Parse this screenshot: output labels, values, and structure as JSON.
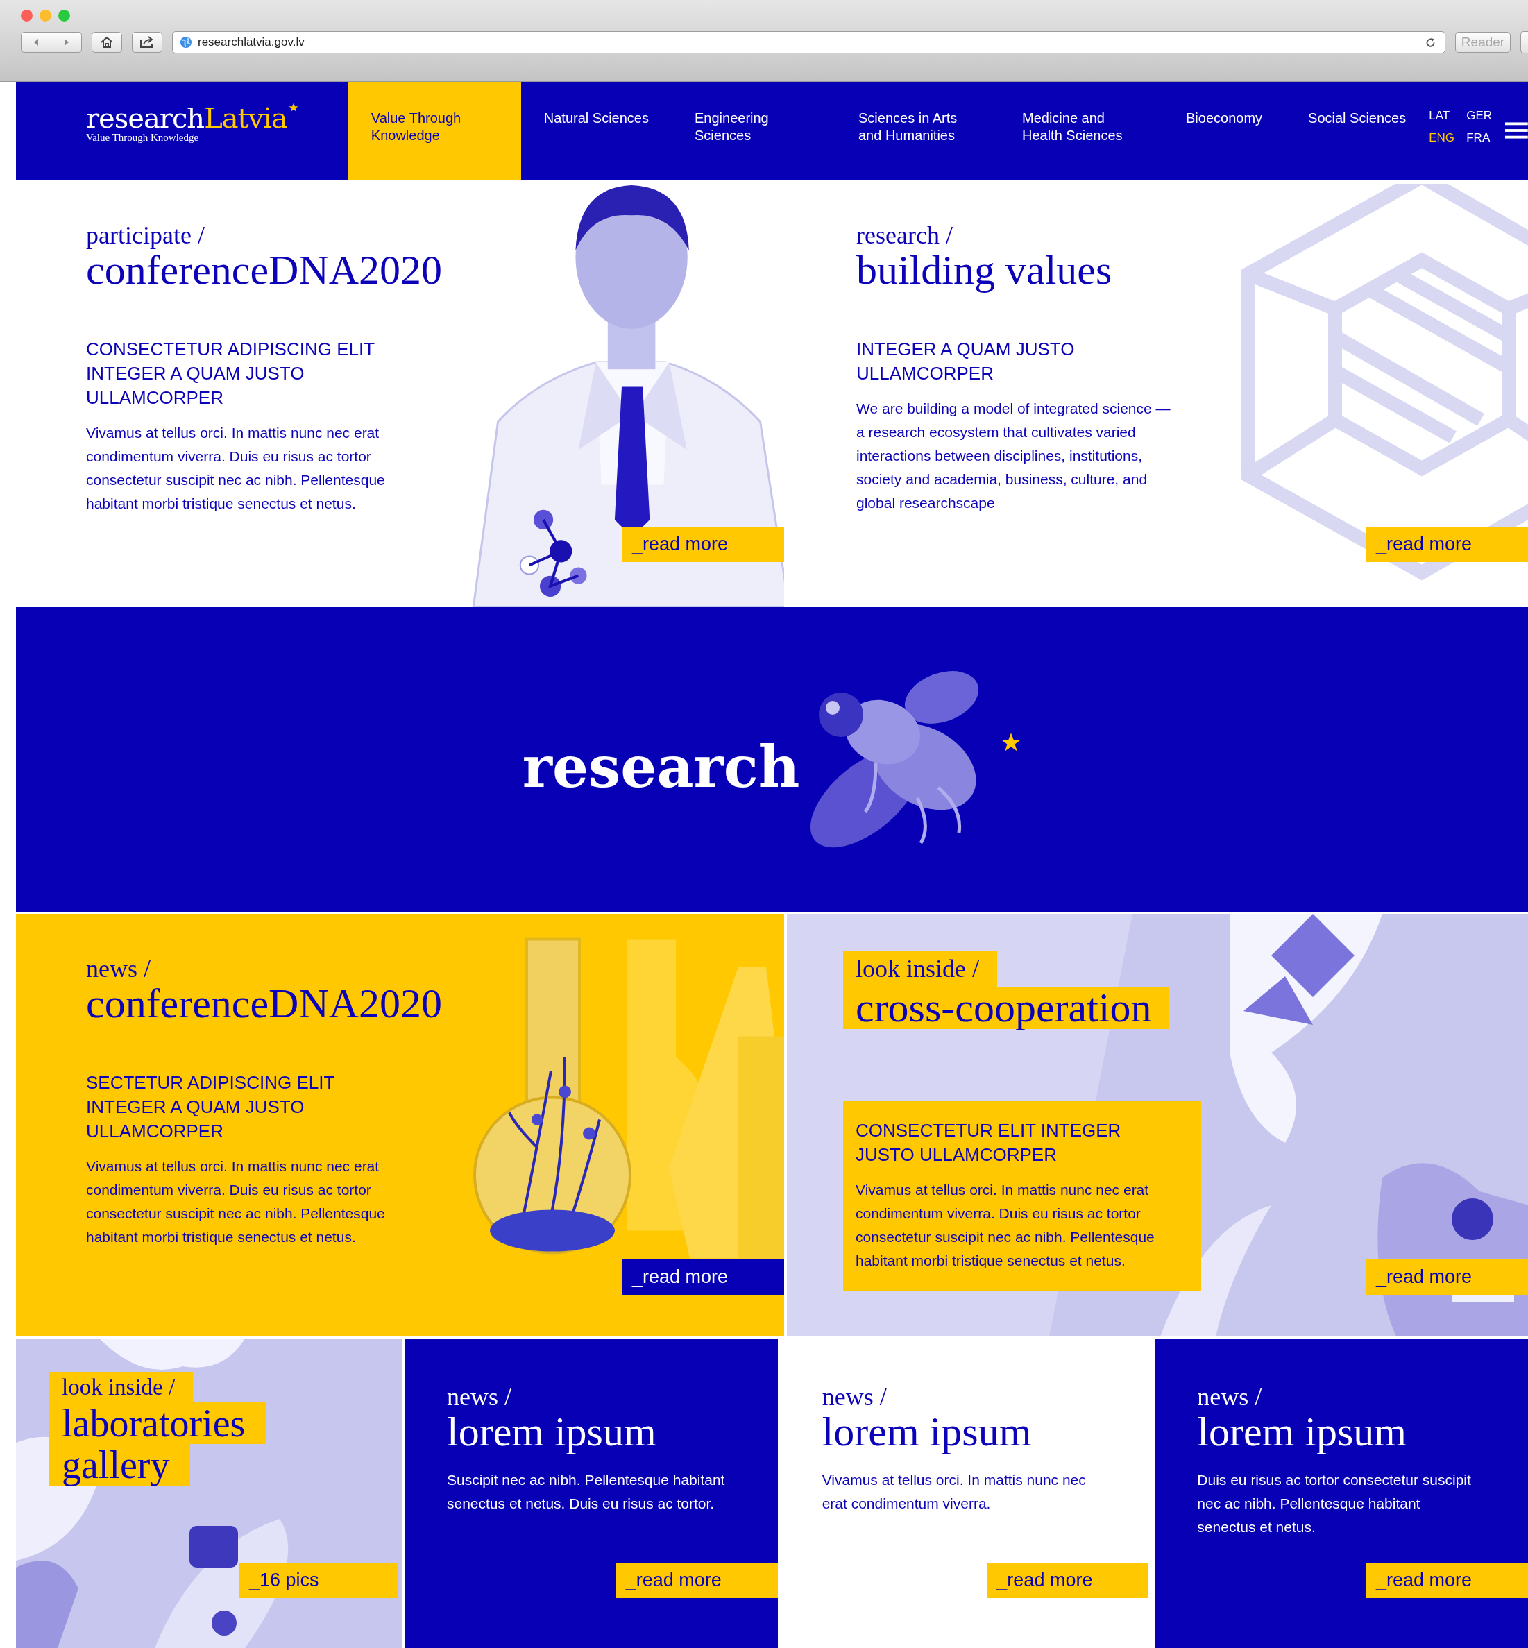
{
  "browser": {
    "url": "researchlatvia.gov.lv",
    "reader": "Reader"
  },
  "header": {
    "logo": {
      "first": "research",
      "second": "Latvia",
      "tagline": "Value Through Knowledge"
    },
    "nav": [
      {
        "label": "Value Through Knowledge",
        "selected": true
      },
      {
        "label": "Natural Sciences",
        "selected": false
      },
      {
        "label": "Engineering Sciences",
        "selected": false
      },
      {
        "label": "Sciences in Arts and Humanities",
        "selected": false
      },
      {
        "label": "Medicine and Health Sciences",
        "selected": false
      },
      {
        "label": "Bioeconomy",
        "selected": false
      },
      {
        "label": "Social Sciences",
        "selected": false
      }
    ],
    "languages": [
      {
        "label": "LAT",
        "selected": false
      },
      {
        "label": "GER",
        "selected": false
      },
      {
        "label": "ENG",
        "selected": true
      },
      {
        "label": "FRA",
        "selected": false
      }
    ]
  },
  "top_cards": [
    {
      "kind": "person",
      "category": "participate /",
      "title": "conferenceDNA2020",
      "subtitle": "CONSECTETUR ADIPISCING ELIT INTEGER A QUAM JUSTO ULLAMCORPER",
      "body": "Vivamus at tellus orci. In mattis nunc nec erat condimentum viverra. Duis eu risus ac tortor consectetur suscipit nec ac nibh. Pellentesque habitant morbi tristique senectus et netus.",
      "button": "_read more"
    },
    {
      "kind": "hexagon",
      "category": "research /",
      "title": "building values",
      "subtitle": "INTEGER A QUAM JUSTO ULLAMCORPER",
      "body": "We are building a model of integrated science — a research ecosystem that cultivates varied interactions between disciplines, institutions, society and academia, business, culture, and global researchscape",
      "button": "_read more"
    }
  ],
  "banner": {
    "word": "research"
  },
  "feature_cards": [
    {
      "kind": "standard",
      "category": "news /",
      "title": "conferenceDNA2020",
      "subtitle": "SECTETUR ADIPISCING ELIT INTEGER A QUAM JUSTO ULLAMCORPER",
      "body": "Vivamus at tellus orci. In mattis nunc nec erat condimentum viverra. Duis eu risus ac tortor consectetur suscipit nec ac nibh. Pellentesque habitant morbi tristique senectus et netus.",
      "button": "_read more"
    },
    {
      "kind": "overlay",
      "category": "look inside /",
      "title": "cross-cooperation",
      "subtitle": "CONSECTETUR ELIT INTEGER JUSTO ULLAMCORPER",
      "body": "Vivamus at tellus orci. In mattis nunc nec erat condimentum viverra. Duis eu risus ac tortor consectetur suscipit nec ac nibh. Pellentesque habitant morbi tristique senectus et netus.",
      "button": "_read more"
    }
  ],
  "gallery": {
    "category": "look inside /",
    "title_lines": [
      "laboratories",
      "gallery"
    ],
    "button": "_16 pics"
  },
  "news": [
    {
      "inverted": true,
      "category": "news /",
      "title": "lorem ipsum",
      "body": "Suscipit nec ac nibh. Pellentesque habitant senectus et netus. Duis eu risus ac tortor.",
      "button": "_read more"
    },
    {
      "inverted": false,
      "category": "news /",
      "title": "lorem ipsum",
      "body": "Vivamus at tellus orci. In mattis nunc nec erat condimentum viverra.",
      "button": "_read more"
    },
    {
      "inverted": true,
      "category": "news /",
      "title": "lorem ipsum",
      "body": "Duis eu risus ac tortor consectetur suscipit nec ac nibh. Pellentesque habitant senectus et netus.",
      "button": "_read more"
    }
  ]
}
